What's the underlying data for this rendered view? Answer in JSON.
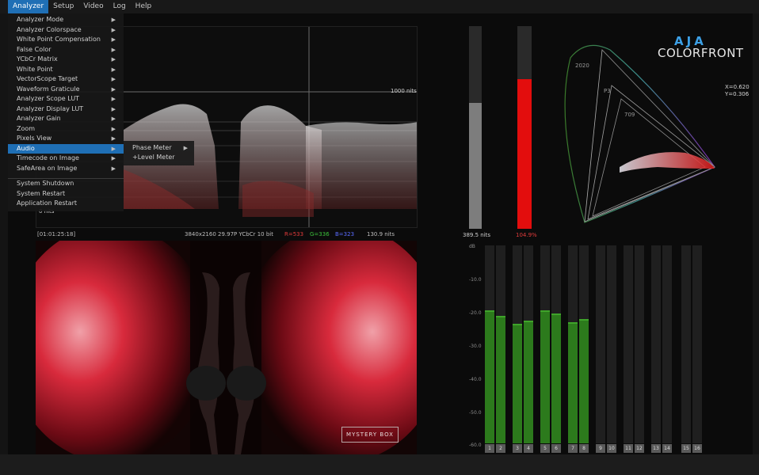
{
  "menubar": {
    "items": [
      {
        "label": "Analyzer",
        "active": true
      },
      {
        "label": "Setup",
        "active": false
      },
      {
        "label": "Video",
        "active": false
      },
      {
        "label": "Log",
        "active": false
      },
      {
        "label": "Help",
        "active": false
      }
    ]
  },
  "analyzer_menu": {
    "items": [
      {
        "label": "Analyzer Mode",
        "submenu": true
      },
      {
        "label": "Analyzer Colorspace",
        "submenu": true
      },
      {
        "label": "White Point Compensation",
        "submenu": true
      },
      {
        "label": "False Color",
        "submenu": true
      },
      {
        "label": "YCbCr Matrix",
        "submenu": true
      },
      {
        "label": "White Point",
        "submenu": true
      },
      {
        "label": "VectorScope Target",
        "submenu": true
      },
      {
        "label": "Waveform Graticule",
        "submenu": true
      },
      {
        "label": "Analyzer Scope LUT",
        "submenu": true
      },
      {
        "label": "Analyzer Display LUT",
        "submenu": true
      },
      {
        "label": "Analyzer Gain",
        "submenu": true
      },
      {
        "label": "Zoom",
        "submenu": true
      },
      {
        "label": "Pixels View",
        "submenu": true
      },
      {
        "label": "Audio",
        "submenu": true,
        "active": true
      },
      {
        "label": "Timecode on Image",
        "submenu": true
      },
      {
        "label": "SafeArea on Image",
        "submenu": true
      }
    ],
    "system_items": [
      {
        "label": "System Shutdown"
      },
      {
        "label": "System Restart"
      },
      {
        "label": "Application Restart"
      }
    ]
  },
  "audio_submenu": {
    "items": [
      {
        "label": "Phase Meter",
        "submenu": true
      },
      {
        "label": "+Level Meter",
        "submenu": false
      }
    ]
  },
  "waveform": {
    "top_label": "1000 nits",
    "bottom_label": "0 nits"
  },
  "status": {
    "timecode": "[01:01:25:18]",
    "format": "3840x2160 29.97P YCbCr 10 bit",
    "r": "R=533",
    "g": "G=336",
    "b": "B=323",
    "nits": "130.9 nits",
    "r_color": "#e23b3b",
    "g_color": "#3cc23c",
    "b_color": "#5a6cff"
  },
  "luminance_meter": {
    "value_label": "389.5 nits",
    "level": 0.62
  },
  "red_meter": {
    "value_label": "104.9%",
    "level": 0.74,
    "color": "#e30d0d"
  },
  "cie": {
    "labels": [
      "2020",
      "P3",
      "709"
    ],
    "x": "X=0.620",
    "y": "Y=0.306"
  },
  "logo": {
    "brand": "AJA",
    "product": "COLORFRONT"
  },
  "video": {
    "overlay": "MYSTERY BOX"
  },
  "audio_meters": {
    "db_labels": [
      "dB",
      "-10.0",
      "-20.0",
      "-30.0",
      "-40.0",
      "-50.0",
      "-60.0"
    ],
    "channels": [
      {
        "label": "1",
        "level": 0.672
      },
      {
        "label": "2",
        "level": 0.644
      },
      {
        "label": "3",
        "level": 0.604
      },
      {
        "label": "4",
        "level": 0.62
      },
      {
        "label": "5",
        "level": 0.672
      },
      {
        "label": "6",
        "level": 0.656
      },
      {
        "label": "7",
        "level": 0.612
      },
      {
        "label": "8",
        "level": 0.628
      },
      {
        "label": "9",
        "level": 0
      },
      {
        "label": "10",
        "level": 0
      },
      {
        "label": "11",
        "level": 0
      },
      {
        "label": "12",
        "level": 0
      },
      {
        "label": "13",
        "level": 0
      },
      {
        "label": "14",
        "level": 0
      },
      {
        "label": "15",
        "level": 0
      },
      {
        "label": "16",
        "level": 0
      }
    ]
  }
}
